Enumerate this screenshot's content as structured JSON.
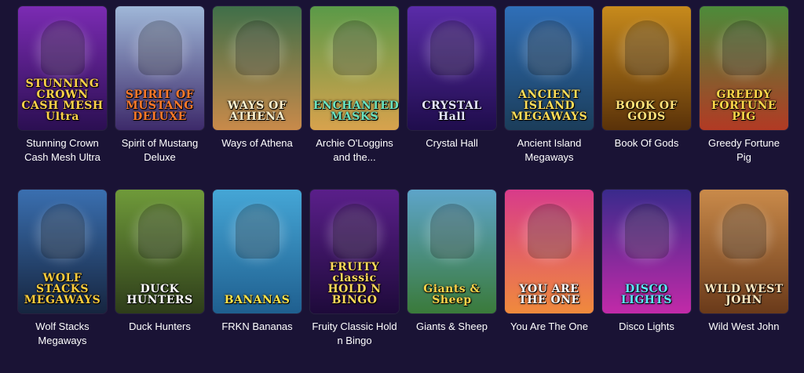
{
  "games": [
    {
      "title": "Stunning Crown Cash Mesh Ultra",
      "logo": "STUNNING CROWN CASH MESH Ultra",
      "bg": "#7b2bb3",
      "bg2": "#2b0f52",
      "logo_color": "#ffd24a"
    },
    {
      "title": "Spirit of Mustang Deluxe",
      "logo": "SPIRIT OF MUSTANG DELUXE",
      "bg": "#9fb7d8",
      "bg2": "#3d2a6a",
      "logo_color": "#ff7a2a"
    },
    {
      "title": "Ways of Athena",
      "logo": "WAYS OF ATHENA",
      "bg": "#3f6f49",
      "bg2": "#c98a4a",
      "logo_color": "#fff3d0"
    },
    {
      "title": "Archie O'Loggins and the...",
      "logo": "ENCHANTED MASKS",
      "bg": "#5a9a48",
      "bg2": "#d8a24d",
      "logo_color": "#6ae3c0"
    },
    {
      "title": "Crystal Hall",
      "logo": "CRYSTAL Hall",
      "bg": "#5a2ba8",
      "bg2": "#1f0d4c",
      "logo_color": "#e6e6ff"
    },
    {
      "title": "Ancient Island Megaways",
      "logo": "ANCIENT ISLAND MEGAWAYS",
      "bg": "#2f6fb8",
      "bg2": "#1b3d5a",
      "logo_color": "#ffde59"
    },
    {
      "title": "Book Of Gods",
      "logo": "BOOK OF GODS",
      "bg": "#c78a1c",
      "bg2": "#5a3209",
      "logo_color": "#ffe27a"
    },
    {
      "title": "Greedy Fortune Pig",
      "logo": "GREEDY FORTUNE PIG",
      "bg": "#4c8b3a",
      "bg2": "#b23a24",
      "logo_color": "#ffd84a"
    },
    {
      "title": "Wolf Stacks Megaways",
      "logo": "WOLF STACKS MEGAWAYS",
      "bg": "#3a6fb0",
      "bg2": "#16253f",
      "logo_color": "#ffcd3c"
    },
    {
      "title": "Duck Hunters",
      "logo": "DUCK HUNTERS",
      "bg": "#6f9a3a",
      "bg2": "#2e3d1a",
      "logo_color": "#ffffff"
    },
    {
      "title": "FRKN Bananas",
      "logo": "BANANAS",
      "bg": "#45a6d6",
      "bg2": "#1f5f8f",
      "logo_color": "#ffe44a"
    },
    {
      "title": "Fruity Classic Hold n Bingo",
      "logo": "FRUITY classic HOLD N BINGO",
      "bg": "#5a1f8a",
      "bg2": "#1e0a3a",
      "logo_color": "#ffd95a"
    },
    {
      "title": "Giants & Sheep",
      "logo": "Giants & Sheep",
      "bg": "#5da4c9",
      "bg2": "#3a7a3a",
      "logo_color": "#ffd44a"
    },
    {
      "title": "You Are The One",
      "logo": "YOU ARE THE ONE",
      "bg": "#d83b8a",
      "bg2": "#f08a3c",
      "logo_color": "#ffffff"
    },
    {
      "title": "Disco Lights",
      "logo": "DISCO LIGHTS",
      "bg": "#3a2a8c",
      "bg2": "#c22aa8",
      "logo_color": "#5ce8ff"
    },
    {
      "title": "Wild West John",
      "logo": "WILD WEST JOHN",
      "bg": "#c98a4a",
      "bg2": "#6a3a1a",
      "logo_color": "#ffe8c0"
    }
  ]
}
